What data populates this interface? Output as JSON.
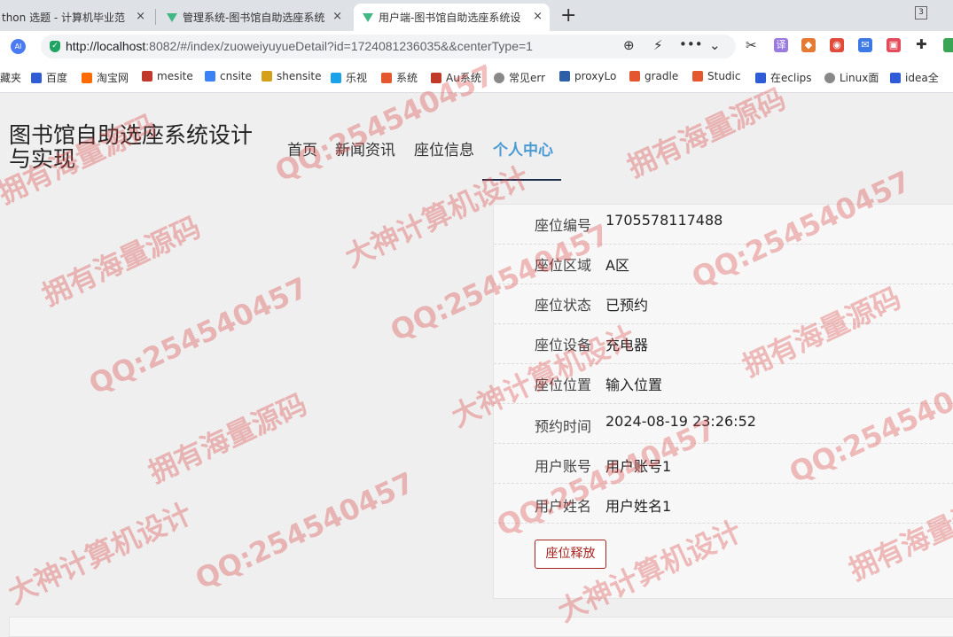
{
  "browser": {
    "tabs": [
      {
        "title": "thon 选题 - 计算机毕业范",
        "close": "×"
      },
      {
        "title": "管理系统-图书馆自助选座系统",
        "close": "×"
      },
      {
        "title": "用户端-图书馆自助选座系统设",
        "close": "×"
      }
    ],
    "new_tab": "+",
    "tab_count": "3",
    "ai_badge": "AI",
    "url_host": "http://localhost",
    "url_rest": ":8082/#/index/zuoweiyuyueDetail?id=1724081236035&&centerType=1",
    "bookmarks": [
      {
        "label": "藏夹",
        "color": "#888888"
      },
      {
        "label": "百度",
        "color": "#2f5bd6"
      },
      {
        "label": "淘宝网",
        "color": "#ff6a00"
      },
      {
        "label": "mesite",
        "color": "#c0392b"
      },
      {
        "label": "cnsite",
        "color": "#3b82f6"
      },
      {
        "label": "shensite",
        "color": "#d4a017"
      },
      {
        "label": "乐视",
        "color": "#1aa3e8"
      },
      {
        "label": "系统",
        "color": "#e4572e"
      },
      {
        "label": "Au系统",
        "color": "#c0392b"
      },
      {
        "label": "常见err",
        "color": "#888888"
      },
      {
        "label": "proxyLo",
        "color": "#2c5fa8"
      },
      {
        "label": "gradle",
        "color": "#e4572e"
      },
      {
        "label": "Studic",
        "color": "#e4572e"
      },
      {
        "label": "在eclips",
        "color": "#2f5bd6"
      },
      {
        "label": "Linux面",
        "color": "#888888"
      },
      {
        "label": "idea全",
        "color": "#2f5bd6"
      }
    ]
  },
  "site": {
    "title": "图书馆自助选座系统设计与实现",
    "nav": [
      "首页",
      "新闻资讯",
      "座位信息",
      "个人中心"
    ],
    "active_nav": "个人中心"
  },
  "detail": {
    "rows": [
      {
        "label": "座位编号",
        "value": "1705578117488"
      },
      {
        "label": "座位区域",
        "value": "A区"
      },
      {
        "label": "座位状态",
        "value": "已预约"
      },
      {
        "label": "座位设备",
        "value": "充电器"
      },
      {
        "label": "座位位置",
        "value": "输入位置"
      },
      {
        "label": "预约时间",
        "value": "2024-08-19 23:26:52"
      },
      {
        "label": "用户账号",
        "value": "用户账号1"
      },
      {
        "label": "用户姓名",
        "value": "用户姓名1"
      }
    ],
    "release_button": "座位释放"
  },
  "watermarks": [
    "拥有海量源码",
    "QQ:254540457",
    "大神计算机设计"
  ],
  "colors": {
    "accent": "#4a9ad4",
    "danger": "#a8231e",
    "nav_underline": "#1f2f4a"
  }
}
